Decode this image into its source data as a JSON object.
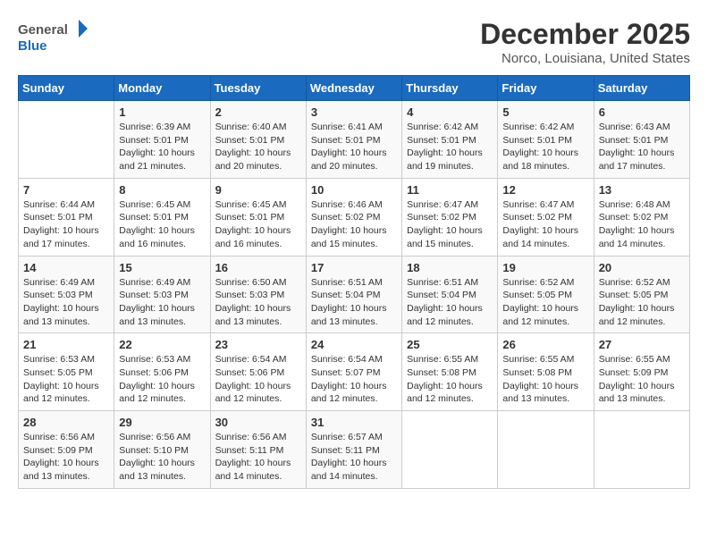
{
  "header": {
    "logo_line1": "General",
    "logo_line2": "Blue",
    "month_title": "December 2025",
    "location": "Norco, Louisiana, United States"
  },
  "days_of_week": [
    "Sunday",
    "Monday",
    "Tuesday",
    "Wednesday",
    "Thursday",
    "Friday",
    "Saturday"
  ],
  "weeks": [
    [
      {
        "day": "",
        "info": ""
      },
      {
        "day": "1",
        "info": "Sunrise: 6:39 AM\nSunset: 5:01 PM\nDaylight: 10 hours\nand 21 minutes."
      },
      {
        "day": "2",
        "info": "Sunrise: 6:40 AM\nSunset: 5:01 PM\nDaylight: 10 hours\nand 20 minutes."
      },
      {
        "day": "3",
        "info": "Sunrise: 6:41 AM\nSunset: 5:01 PM\nDaylight: 10 hours\nand 20 minutes."
      },
      {
        "day": "4",
        "info": "Sunrise: 6:42 AM\nSunset: 5:01 PM\nDaylight: 10 hours\nand 19 minutes."
      },
      {
        "day": "5",
        "info": "Sunrise: 6:42 AM\nSunset: 5:01 PM\nDaylight: 10 hours\nand 18 minutes."
      },
      {
        "day": "6",
        "info": "Sunrise: 6:43 AM\nSunset: 5:01 PM\nDaylight: 10 hours\nand 17 minutes."
      }
    ],
    [
      {
        "day": "7",
        "info": "Sunrise: 6:44 AM\nSunset: 5:01 PM\nDaylight: 10 hours\nand 17 minutes."
      },
      {
        "day": "8",
        "info": "Sunrise: 6:45 AM\nSunset: 5:01 PM\nDaylight: 10 hours\nand 16 minutes."
      },
      {
        "day": "9",
        "info": "Sunrise: 6:45 AM\nSunset: 5:01 PM\nDaylight: 10 hours\nand 16 minutes."
      },
      {
        "day": "10",
        "info": "Sunrise: 6:46 AM\nSunset: 5:02 PM\nDaylight: 10 hours\nand 15 minutes."
      },
      {
        "day": "11",
        "info": "Sunrise: 6:47 AM\nSunset: 5:02 PM\nDaylight: 10 hours\nand 15 minutes."
      },
      {
        "day": "12",
        "info": "Sunrise: 6:47 AM\nSunset: 5:02 PM\nDaylight: 10 hours\nand 14 minutes."
      },
      {
        "day": "13",
        "info": "Sunrise: 6:48 AM\nSunset: 5:02 PM\nDaylight: 10 hours\nand 14 minutes."
      }
    ],
    [
      {
        "day": "14",
        "info": "Sunrise: 6:49 AM\nSunset: 5:03 PM\nDaylight: 10 hours\nand 13 minutes."
      },
      {
        "day": "15",
        "info": "Sunrise: 6:49 AM\nSunset: 5:03 PM\nDaylight: 10 hours\nand 13 minutes."
      },
      {
        "day": "16",
        "info": "Sunrise: 6:50 AM\nSunset: 5:03 PM\nDaylight: 10 hours\nand 13 minutes."
      },
      {
        "day": "17",
        "info": "Sunrise: 6:51 AM\nSunset: 5:04 PM\nDaylight: 10 hours\nand 13 minutes."
      },
      {
        "day": "18",
        "info": "Sunrise: 6:51 AM\nSunset: 5:04 PM\nDaylight: 10 hours\nand 12 minutes."
      },
      {
        "day": "19",
        "info": "Sunrise: 6:52 AM\nSunset: 5:05 PM\nDaylight: 10 hours\nand 12 minutes."
      },
      {
        "day": "20",
        "info": "Sunrise: 6:52 AM\nSunset: 5:05 PM\nDaylight: 10 hours\nand 12 minutes."
      }
    ],
    [
      {
        "day": "21",
        "info": "Sunrise: 6:53 AM\nSunset: 5:05 PM\nDaylight: 10 hours\nand 12 minutes."
      },
      {
        "day": "22",
        "info": "Sunrise: 6:53 AM\nSunset: 5:06 PM\nDaylight: 10 hours\nand 12 minutes."
      },
      {
        "day": "23",
        "info": "Sunrise: 6:54 AM\nSunset: 5:06 PM\nDaylight: 10 hours\nand 12 minutes."
      },
      {
        "day": "24",
        "info": "Sunrise: 6:54 AM\nSunset: 5:07 PM\nDaylight: 10 hours\nand 12 minutes."
      },
      {
        "day": "25",
        "info": "Sunrise: 6:55 AM\nSunset: 5:08 PM\nDaylight: 10 hours\nand 12 minutes."
      },
      {
        "day": "26",
        "info": "Sunrise: 6:55 AM\nSunset: 5:08 PM\nDaylight: 10 hours\nand 13 minutes."
      },
      {
        "day": "27",
        "info": "Sunrise: 6:55 AM\nSunset: 5:09 PM\nDaylight: 10 hours\nand 13 minutes."
      }
    ],
    [
      {
        "day": "28",
        "info": "Sunrise: 6:56 AM\nSunset: 5:09 PM\nDaylight: 10 hours\nand 13 minutes."
      },
      {
        "day": "29",
        "info": "Sunrise: 6:56 AM\nSunset: 5:10 PM\nDaylight: 10 hours\nand 13 minutes."
      },
      {
        "day": "30",
        "info": "Sunrise: 6:56 AM\nSunset: 5:11 PM\nDaylight: 10 hours\nand 14 minutes."
      },
      {
        "day": "31",
        "info": "Sunrise: 6:57 AM\nSunset: 5:11 PM\nDaylight: 10 hours\nand 14 minutes."
      },
      {
        "day": "",
        "info": ""
      },
      {
        "day": "",
        "info": ""
      },
      {
        "day": "",
        "info": ""
      }
    ]
  ]
}
